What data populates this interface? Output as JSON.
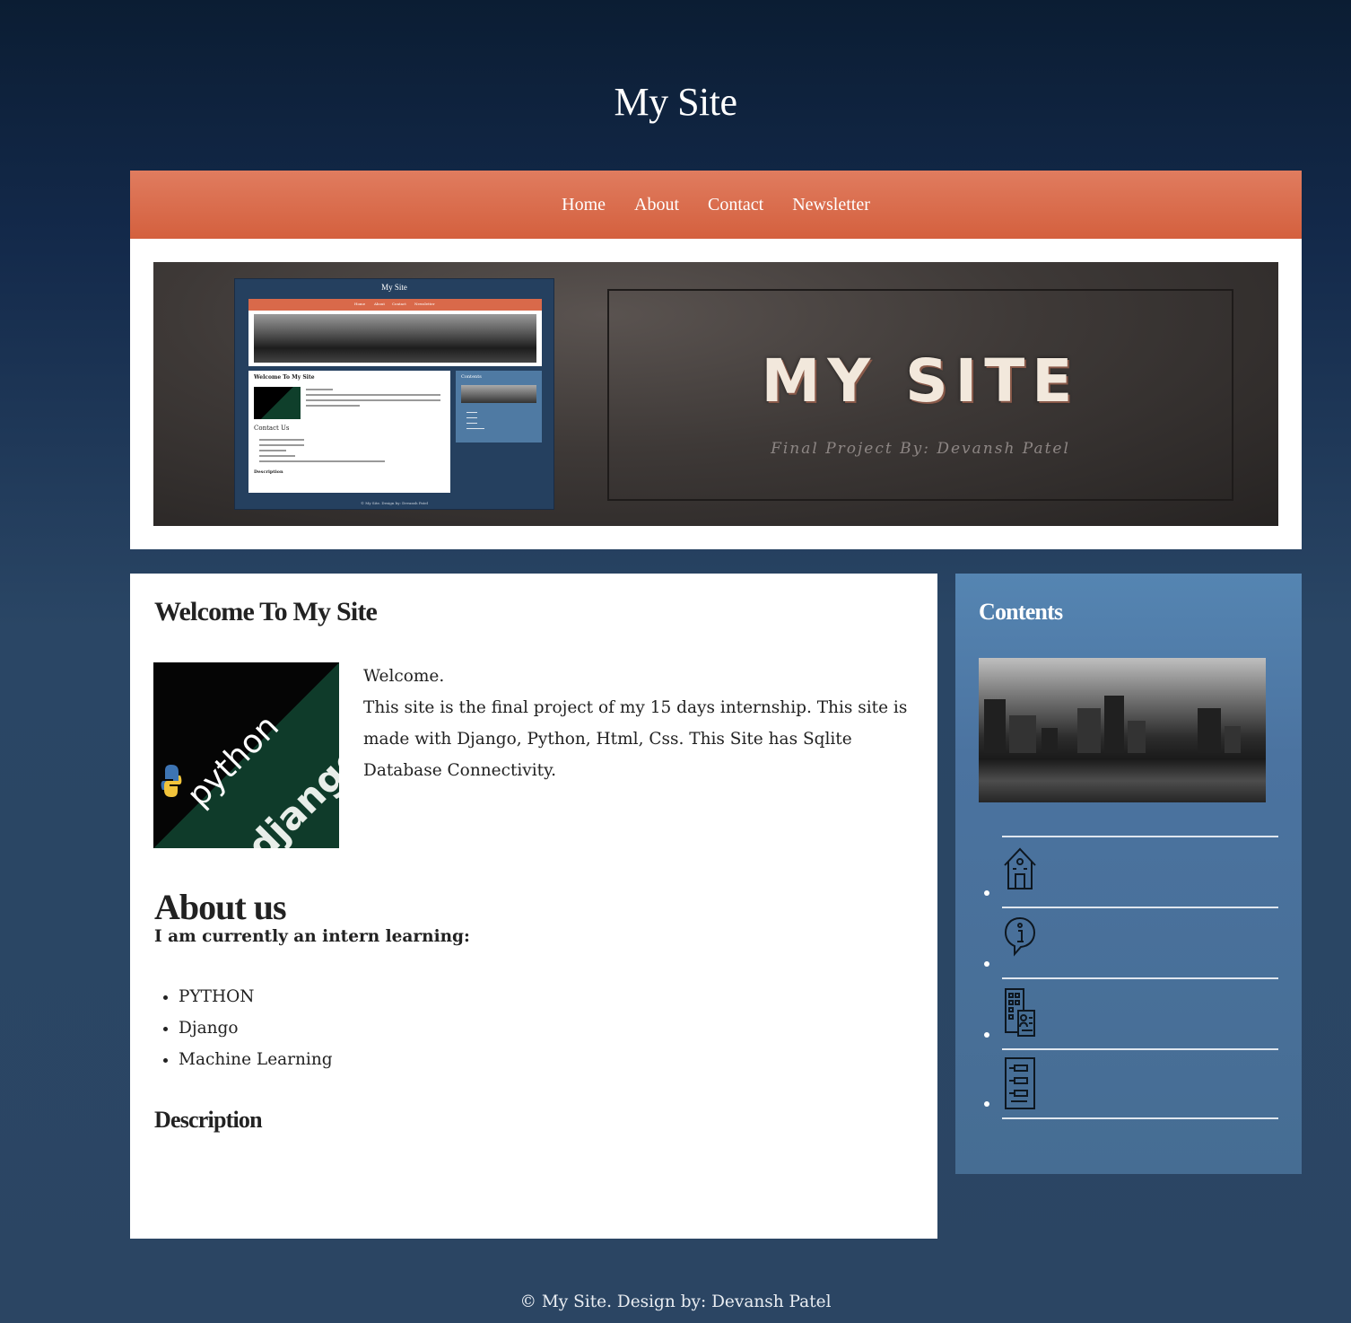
{
  "site": {
    "title": "My Site"
  },
  "nav": {
    "items": [
      "Home",
      "About",
      "Contact",
      "Newsletter"
    ]
  },
  "banner": {
    "title": "MY SITE",
    "subtitle": "Final Project By: Devansh Patel",
    "mini": {
      "title": "My Site",
      "nav": [
        "Home",
        "About",
        "Contact",
        "Newsletter"
      ],
      "welcome": "Welcome To My Site",
      "contact_heading": "Contact Us",
      "description_heading": "Description",
      "contents_heading": "Contents",
      "footer": "© My Site. Design by: Devansh Patel"
    }
  },
  "main": {
    "welcome_heading": "Welcome To My Site",
    "welcome_line": "Welcome.",
    "welcome_body": "This site is the final project of my 15 days internship. This site is made with Django, Python, Html, Css. This Site has Sqlite Database Connectivity.",
    "logo_text_python": "python",
    "logo_text_django": "django",
    "about_heading": "About us",
    "intern_text": "I am currently an intern learning:",
    "skills": [
      "PYTHON",
      "Django",
      "Machine Learning"
    ],
    "description_heading": "Description"
  },
  "sidebar": {
    "heading": "Contents",
    "icons": [
      "home-icon",
      "info-icon",
      "building-contact-icon",
      "newsletter-icon"
    ]
  },
  "footer": {
    "text": "© My Site. Design by: Devansh Patel"
  },
  "colors": {
    "nav_orange": "#d9694a",
    "bg_navy": "#0b1d33",
    "sidebar_blue": "#4b73a0"
  }
}
